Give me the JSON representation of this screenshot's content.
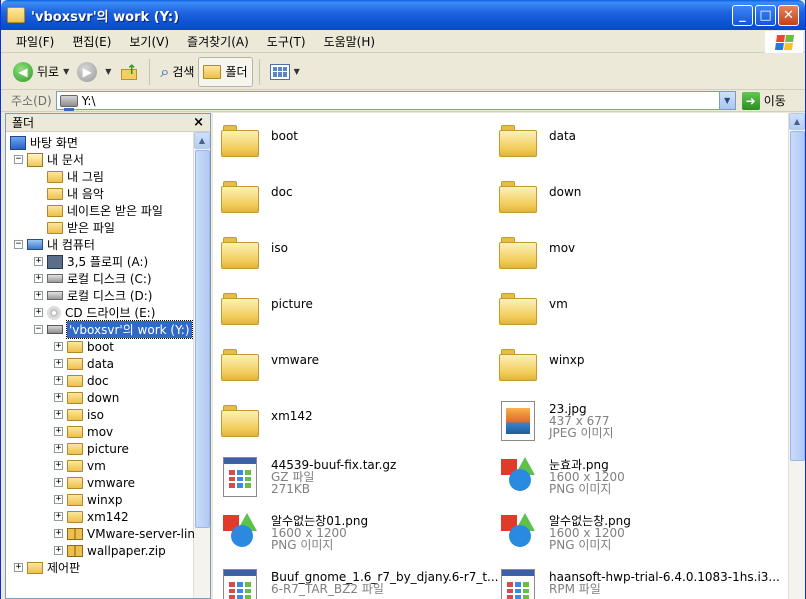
{
  "window": {
    "title": "'vboxsvr'의 work (Y:)"
  },
  "menu": [
    "파일(F)",
    "편집(E)",
    "보기(V)",
    "즐겨찾기(A)",
    "도구(T)",
    "도움말(H)"
  ],
  "toolbar": {
    "back_label": "뒤로",
    "search_label": "검색",
    "folders_label": "폴더"
  },
  "address": {
    "label": "주소(D)",
    "value": "Y:\\",
    "go_label": "이동"
  },
  "folder_pane": {
    "title": "폴더",
    "close_glyph": "×",
    "tree": [
      {
        "label": "바탕 화면",
        "indent": 0,
        "expander": "",
        "icon": "desktop"
      },
      {
        "label": "내 문서",
        "indent": 1,
        "expander": "−",
        "icon": "mydocs"
      },
      {
        "label": "내 그림",
        "indent": 2,
        "expander": "",
        "icon": "folder"
      },
      {
        "label": "내 음악",
        "indent": 2,
        "expander": "",
        "icon": "folder"
      },
      {
        "label": "네이트온 받은 파일",
        "indent": 2,
        "expander": "",
        "icon": "folder"
      },
      {
        "label": "받은 파일",
        "indent": 2,
        "expander": "",
        "icon": "folder"
      },
      {
        "label": "내 컴퓨터",
        "indent": 1,
        "expander": "−",
        "icon": "pc"
      },
      {
        "label": "3,5 플로피 (A:)",
        "indent": 2,
        "expander": "+",
        "icon": "floppy"
      },
      {
        "label": "로컬 디스크 (C:)",
        "indent": 2,
        "expander": "+",
        "icon": "disk"
      },
      {
        "label": "로컬 디스크 (D:)",
        "indent": 2,
        "expander": "+",
        "icon": "disk"
      },
      {
        "label": "CD 드라이브 (E:)",
        "indent": 2,
        "expander": "+",
        "icon": "cd"
      },
      {
        "label": "'vboxsvr'의 work (Y:)",
        "indent": 2,
        "expander": "−",
        "icon": "netdrive",
        "selected": true
      },
      {
        "label": "boot",
        "indent": 3,
        "expander": "+",
        "icon": "folder"
      },
      {
        "label": "data",
        "indent": 3,
        "expander": "+",
        "icon": "folder"
      },
      {
        "label": "doc",
        "indent": 3,
        "expander": "+",
        "icon": "folder"
      },
      {
        "label": "down",
        "indent": 3,
        "expander": "+",
        "icon": "folder"
      },
      {
        "label": "iso",
        "indent": 3,
        "expander": "+",
        "icon": "folder"
      },
      {
        "label": "mov",
        "indent": 3,
        "expander": "+",
        "icon": "folder"
      },
      {
        "label": "picture",
        "indent": 3,
        "expander": "+",
        "icon": "folder"
      },
      {
        "label": "vm",
        "indent": 3,
        "expander": "+",
        "icon": "folder"
      },
      {
        "label": "vmware",
        "indent": 3,
        "expander": "+",
        "icon": "folder"
      },
      {
        "label": "winxp",
        "indent": 3,
        "expander": "+",
        "icon": "folder"
      },
      {
        "label": "xm142",
        "indent": 3,
        "expander": "+",
        "icon": "folder"
      },
      {
        "label": "VMware-server-lin",
        "indent": 3,
        "expander": "+",
        "icon": "zip"
      },
      {
        "label": "wallpaper.zip",
        "indent": 3,
        "expander": "+",
        "icon": "zip"
      },
      {
        "label": "제어판",
        "indent": 1,
        "expander": "+",
        "icon": "panel"
      }
    ]
  },
  "content": {
    "items": [
      {
        "kind": "folder",
        "name": "boot"
      },
      {
        "kind": "folder",
        "name": "data"
      },
      {
        "kind": "folder",
        "name": "doc"
      },
      {
        "kind": "folder",
        "name": "down"
      },
      {
        "kind": "folder",
        "name": "iso"
      },
      {
        "kind": "folder",
        "name": "mov"
      },
      {
        "kind": "folder",
        "name": "picture"
      },
      {
        "kind": "folder",
        "name": "vm"
      },
      {
        "kind": "folder",
        "name": "vmware"
      },
      {
        "kind": "folder",
        "name": "winxp"
      },
      {
        "kind": "folder",
        "name": "xm142"
      },
      {
        "kind": "jpg",
        "name": "23.jpg",
        "line2": "437 x 677",
        "line3": "JPEG 이미지"
      },
      {
        "kind": "gz",
        "name": "44539-buuf-fix.tar.gz",
        "line2": "GZ 파일",
        "line3": "271KB"
      },
      {
        "kind": "png",
        "name": "눈효과.png",
        "line2": "1600 x 1200",
        "line3": "PNG 이미지"
      },
      {
        "kind": "png",
        "name": "알수없는창01.png",
        "line2": "1600 x 1200",
        "line3": "PNG 이미지"
      },
      {
        "kind": "png",
        "name": "알수없는창.png",
        "line2": "1600 x 1200",
        "line3": "PNG 이미지"
      },
      {
        "kind": "gz",
        "name": "Buuf_gnome_1.6_r7_by_djany.6-r7_t...",
        "line2": "6-R7_TAR_BZ2 파일",
        "line3": ""
      },
      {
        "kind": "gz",
        "name": "haansoft-hwp-trial-6.4.0.1083-1hs.i3...",
        "line2": "RPM 파일",
        "line3": ""
      }
    ]
  }
}
